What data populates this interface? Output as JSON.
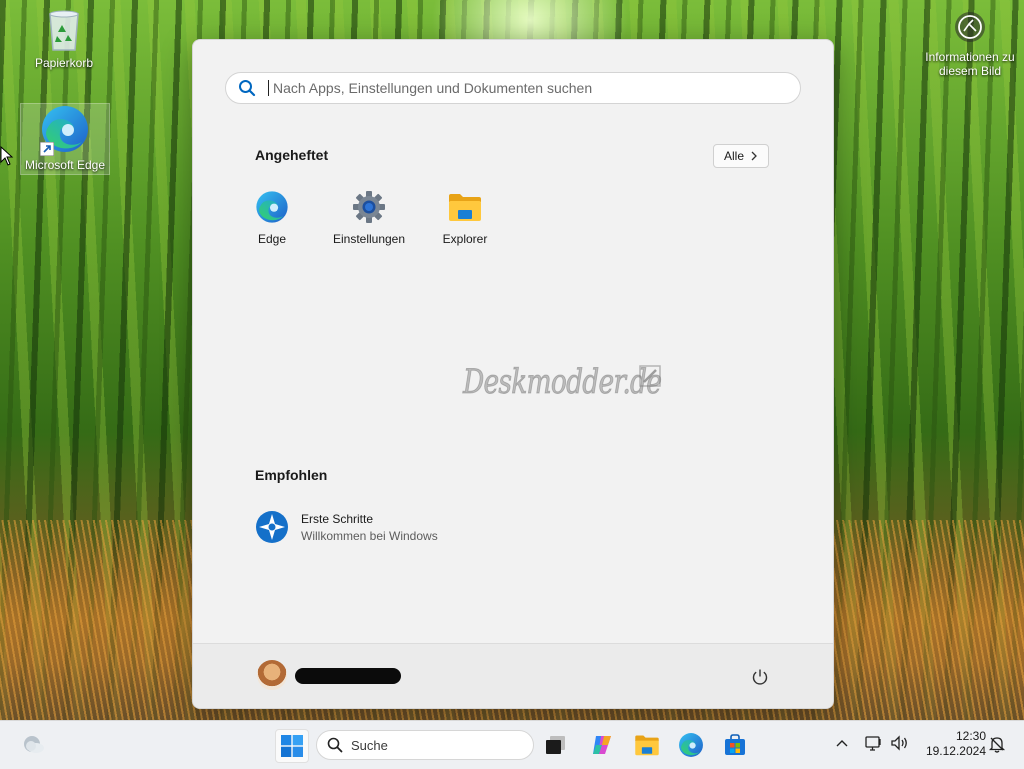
{
  "desktop": {
    "icons": [
      {
        "label": "Papierkorb"
      },
      {
        "label": "Microsoft Edge"
      }
    ],
    "info_label_line1": "Informationen zu",
    "info_label_line2": "diesem Bild"
  },
  "start_menu": {
    "search_placeholder": "Nach Apps, Einstellungen und Dokumenten suchen",
    "pinned_title": "Angeheftet",
    "all_button_label": "Alle",
    "pinned_apps": [
      {
        "label": "Edge",
        "icon": "edge-icon"
      },
      {
        "label": "Einstellungen",
        "icon": "gear-icon"
      },
      {
        "label": "Explorer",
        "icon": "folder-icon"
      }
    ],
    "watermark": "Deskmodder.de",
    "recommended_title": "Empfohlen",
    "recommended_items": [
      {
        "title": "Erste Schritte",
        "subtitle": "Willkommen bei Windows",
        "icon": "get-started-icon"
      }
    ]
  },
  "taskbar": {
    "search_label": "Suche",
    "apps": [
      "windows-start-icon",
      "task-view-icon",
      "copilot-icon",
      "file-explorer-icon",
      "edge-icon",
      "store-icon"
    ],
    "clock_time": "12:30",
    "clock_date": "19.12.2024"
  },
  "colors": {
    "accent": "#0067c0",
    "menu_background": "#f2f2f2",
    "taskbar_background": "#eef0f3"
  }
}
